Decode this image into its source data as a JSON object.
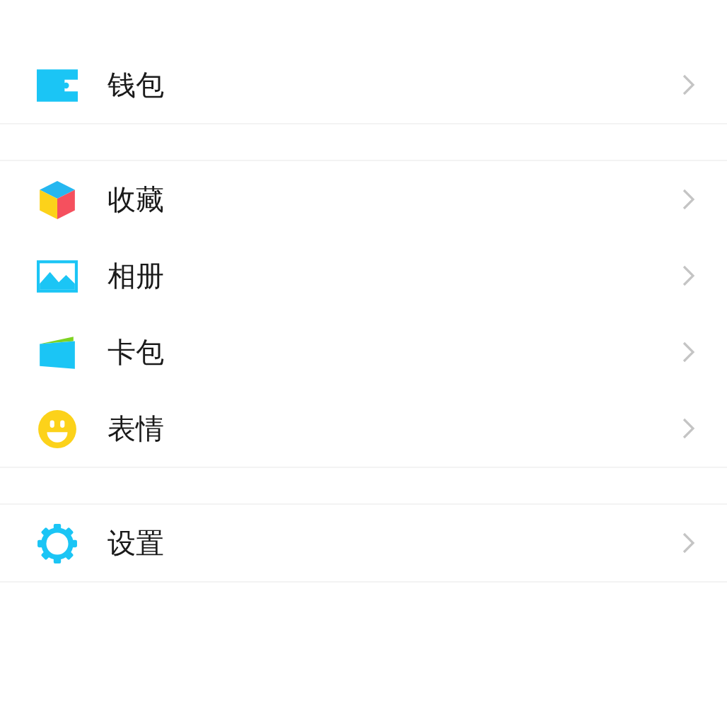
{
  "groups": [
    {
      "items": [
        {
          "label": "钱包",
          "kind": "wallet"
        }
      ]
    },
    {
      "items": [
        {
          "label": "收藏",
          "kind": "cube"
        },
        {
          "label": "相册",
          "kind": "photo"
        },
        {
          "label": "卡包",
          "kind": "card"
        },
        {
          "label": "表情",
          "kind": "smiley"
        }
      ]
    },
    {
      "items": [
        {
          "label": "设置",
          "kind": "gear"
        }
      ]
    }
  ]
}
